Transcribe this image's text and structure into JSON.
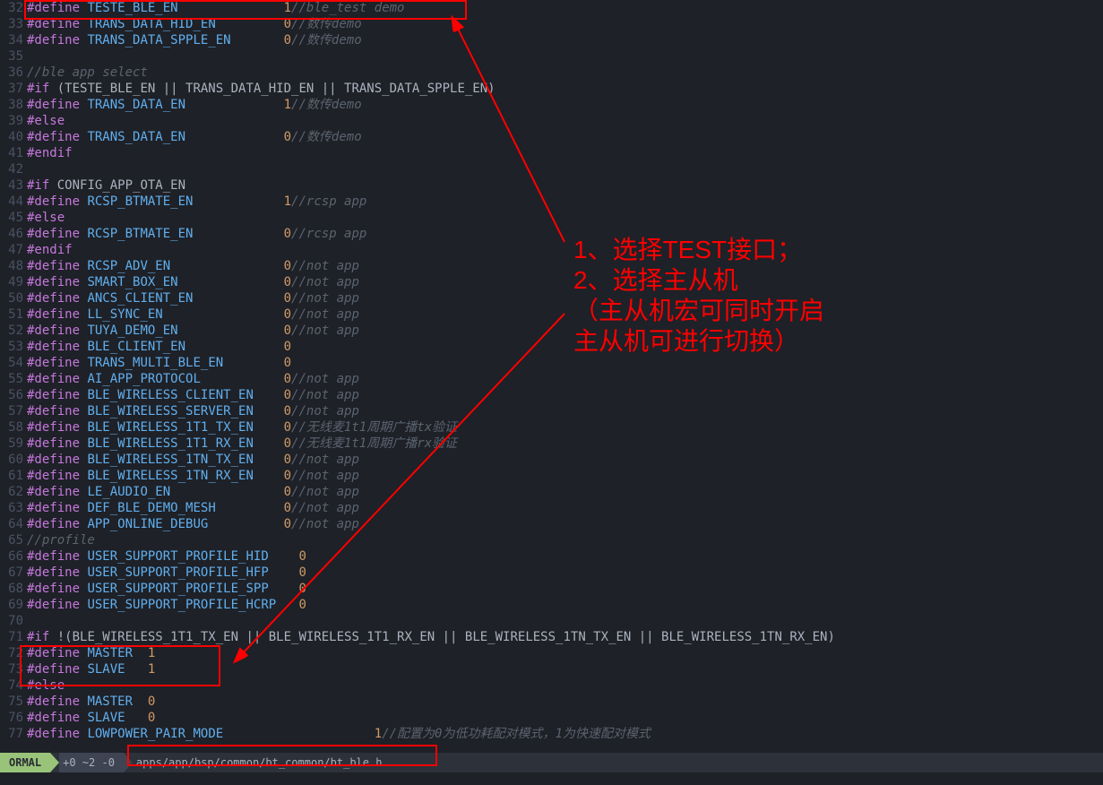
{
  "annotations": {
    "note_line1": "1、选择TEST接口；",
    "note_line2": "2、选择主从机",
    "note_line3": "（主从机宏可同时开启",
    "note_line4": "主从机可进行切换）"
  },
  "statusbar": {
    "mode": "ORMAL",
    "git": "+0 ~2 -0",
    "path": "apps/app/bsp/common/bt_common/bt_ble.h"
  },
  "lines": [
    {
      "n": 32,
      "t": "define",
      "name": "TESTE_BLE_EN",
      "val": "1",
      "c": "//ble_test demo"
    },
    {
      "n": 33,
      "t": "define",
      "name": "TRANS_DATA_HID_EN",
      "val": "0",
      "c": "//数传demo"
    },
    {
      "n": 34,
      "t": "define",
      "name": "TRANS_DATA_SPPLE_EN",
      "val": "0",
      "c": "//数传demo"
    },
    {
      "n": 35,
      "t": "blank"
    },
    {
      "n": 36,
      "t": "comment",
      "c": "//ble app select"
    },
    {
      "n": 37,
      "t": "if",
      "cond": "(TESTE_BLE_EN || TRANS_DATA_HID_EN || TRANS_DATA_SPPLE_EN)"
    },
    {
      "n": 38,
      "t": "define",
      "name": "TRANS_DATA_EN",
      "val": "1",
      "c": "//数传demo"
    },
    {
      "n": 39,
      "t": "else"
    },
    {
      "n": 40,
      "t": "define",
      "name": "TRANS_DATA_EN",
      "val": "0",
      "c": "//数传demo"
    },
    {
      "n": 41,
      "t": "endif"
    },
    {
      "n": 42,
      "t": "blank"
    },
    {
      "n": 43,
      "t": "if",
      "cond": "CONFIG_APP_OTA_EN"
    },
    {
      "n": 44,
      "t": "define",
      "name": "RCSP_BTMATE_EN",
      "val": "1",
      "c": "//rcsp app"
    },
    {
      "n": 45,
      "t": "else"
    },
    {
      "n": 46,
      "t": "define",
      "name": "RCSP_BTMATE_EN",
      "val": "0",
      "c": "//rcsp app"
    },
    {
      "n": 47,
      "t": "endif"
    },
    {
      "n": 48,
      "t": "define",
      "name": "RCSP_ADV_EN",
      "val": "0",
      "c": "//not app"
    },
    {
      "n": 49,
      "t": "define",
      "name": "SMART_BOX_EN",
      "val": "0",
      "c": "//not app"
    },
    {
      "n": 50,
      "t": "define",
      "name": "ANCS_CLIENT_EN",
      "val": "0",
      "c": "//not app"
    },
    {
      "n": 51,
      "t": "define",
      "name": "LL_SYNC_EN",
      "val": "0",
      "c": "//not app"
    },
    {
      "n": 52,
      "t": "define",
      "name": "TUYA_DEMO_EN",
      "val": "0",
      "c": "//not app"
    },
    {
      "n": 53,
      "t": "define",
      "name": "BLE_CLIENT_EN",
      "val": "0"
    },
    {
      "n": 54,
      "t": "define",
      "name": "TRANS_MULTI_BLE_EN",
      "val": "0"
    },
    {
      "n": 55,
      "t": "define",
      "name": "AI_APP_PROTOCOL",
      "val": "0",
      "c": "//not app"
    },
    {
      "n": 56,
      "t": "define",
      "name": "BLE_WIRELESS_CLIENT_EN",
      "val": "0",
      "c": "//not app"
    },
    {
      "n": 57,
      "t": "define",
      "name": "BLE_WIRELESS_SERVER_EN",
      "val": "0",
      "c": "//not app"
    },
    {
      "n": 58,
      "t": "define",
      "name": "BLE_WIRELESS_1T1_TX_EN",
      "val": "0",
      "c": "//无线麦1t1周期广播tx验证"
    },
    {
      "n": 59,
      "t": "define",
      "name": "BLE_WIRELESS_1T1_RX_EN",
      "val": "0",
      "c": "//无线麦1t1周期广播rx验证"
    },
    {
      "n": 60,
      "t": "define",
      "name": "BLE_WIRELESS_1TN_TX_EN",
      "val": "0",
      "c": "//not app"
    },
    {
      "n": 61,
      "t": "define",
      "name": "BLE_WIRELESS_1TN_RX_EN",
      "val": "0",
      "c": "//not app"
    },
    {
      "n": 62,
      "t": "define",
      "name": "LE_AUDIO_EN",
      "val": "0",
      "c": "//not app"
    },
    {
      "n": 63,
      "t": "define",
      "name": "DEF_BLE_DEMO_MESH",
      "val": "0",
      "c": "//not app"
    },
    {
      "n": 64,
      "t": "define",
      "name": "APP_ONLINE_DEBUG",
      "val": "0",
      "c": "//not app"
    },
    {
      "n": 65,
      "t": "comment",
      "c": "//profile"
    },
    {
      "n": 66,
      "t": "define2",
      "name": "USER_SUPPORT_PROFILE_HID",
      "val": "0"
    },
    {
      "n": 67,
      "t": "define2",
      "name": "USER_SUPPORT_PROFILE_HFP",
      "val": "0"
    },
    {
      "n": 68,
      "t": "define2",
      "name": "USER_SUPPORT_PROFILE_SPP",
      "val": "0"
    },
    {
      "n": 69,
      "t": "define2",
      "name": "USER_SUPPORT_PROFILE_HCRP",
      "val": "0"
    },
    {
      "n": 70,
      "t": "blank"
    },
    {
      "n": 71,
      "t": "ifnot",
      "cond": "!(BLE_WIRELESS_1T1_TX_EN || BLE_WIRELESS_1T1_RX_EN || BLE_WIRELESS_1TN_TX_EN || BLE_WIRELESS_1TN_RX_EN)"
    },
    {
      "n": 72,
      "t": "defineshort",
      "name": "MASTER",
      "val": "1"
    },
    {
      "n": 73,
      "t": "defineshort",
      "name": "SLAVE",
      "val": "1"
    },
    {
      "n": 74,
      "t": "else"
    },
    {
      "n": 75,
      "t": "defineshort",
      "name": "MASTER",
      "val": "0"
    },
    {
      "n": 76,
      "t": "defineshort",
      "name": "SLAVE",
      "val": "0"
    },
    {
      "n": 77,
      "t": "define3",
      "name": "LOWPOWER_PAIR_MODE",
      "val": "1",
      "c": "//配置为0为低功耗配对模式，1为快速配对模式"
    }
  ]
}
